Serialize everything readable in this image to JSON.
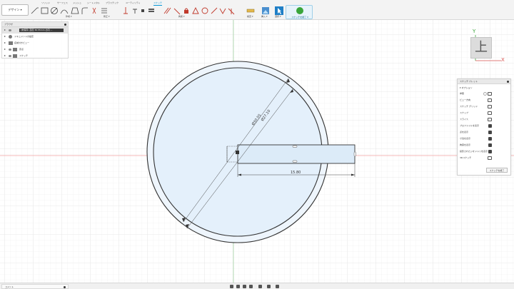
{
  "toolbar": {
    "workspace_label": "デザイン",
    "tabs": [
      {
        "label": "ソリッド",
        "active": false
      },
      {
        "label": "サーフェス",
        "active": false
      },
      {
        "label": "メッシュ",
        "active": false
      },
      {
        "label": "シートメタル",
        "active": false
      },
      {
        "label": "プラスチック",
        "active": false
      },
      {
        "label": "ユーティリティ",
        "active": false
      },
      {
        "label": "スケッチ",
        "active": true
      }
    ],
    "groups": {
      "create": "作成",
      "modify": "修正",
      "constraints": "拘束",
      "inspect": "検査",
      "insert": "挿入",
      "select": "選択",
      "finish": "スケッチを終了"
    },
    "tool_icons": [
      "line-icon",
      "rectangle-icon",
      "circle-icon",
      "arc-icon",
      "polygon-icon",
      "fillet-icon",
      "trim-icon",
      "offset-icon",
      "sketch-dimension-icon",
      "horizontal-constraint-icon",
      "coincident-icon",
      "tangent-icon",
      "equal-icon",
      "parallel-icon",
      "perpendicular-icon",
      "fix-icon",
      "midpoint-icon",
      "concentric-icon",
      "collinear-icon",
      "symmetry-icon",
      "curvature-icon",
      "measure-icon",
      "insert-image-icon",
      "select-icon",
      "finish-check-icon"
    ]
  },
  "browser": {
    "title": "ブラウザ",
    "root_label": "(未保存) 直径 30.55mm の円 ...",
    "items": [
      {
        "label": "ドキュメントの設定"
      },
      {
        "label": "名前付きビュー"
      },
      {
        "label": "原点"
      },
      {
        "label": "スケッチ"
      }
    ]
  },
  "viewcube": {
    "face_label": "上",
    "axis_x": "X",
    "axis_y": "Y"
  },
  "sketch": {
    "dimension_outer": "Ø30.55",
    "dimension_inner": "Ø27.10",
    "dimension_length": "15.80"
  },
  "palette": {
    "title": "スケッチ パレット",
    "section_label": "オプション",
    "rows": [
      {
        "label": "参照",
        "icon": "look-at-icon"
      },
      {
        "label": "ビュー方向",
        "icon": "view-direction-icon"
      },
      {
        "label": "スケッチ グリッド",
        "icon": "checkbox"
      },
      {
        "label": "スナップ",
        "icon": "checkbox"
      },
      {
        "label": "スライス",
        "icon": "checkbox"
      },
      {
        "label": "プロファイルを表示",
        "icon": "checkbox"
      },
      {
        "label": "点を表示",
        "icon": "checkbox"
      },
      {
        "label": "寸法を表示",
        "icon": "checkbox"
      },
      {
        "label": "拘束を表示",
        "icon": "checkbox"
      },
      {
        "label": "投影されたジオメトリを表示",
        "icon": "checkbox"
      },
      {
        "label": "3Dスケッチ",
        "icon": "checkbox"
      }
    ],
    "finish_label": "スケッチを終了"
  },
  "bottombar": {
    "comments_label": "コメント",
    "nav_icons": [
      "orbit-icon",
      "pan-icon",
      "zoom-icon",
      "fit-icon",
      "display-settings-icon",
      "grid-settings-icon",
      "viewports-icon"
    ]
  },
  "colors": {
    "accent": "#0696d7",
    "profile_fill": "#e8f2fb",
    "sketch_line": "#333333",
    "grid": "#e5e5e5",
    "grid_major": "#d6d6d6",
    "x_axis": "#f2a0a0",
    "y_axis": "#9fd59f"
  }
}
